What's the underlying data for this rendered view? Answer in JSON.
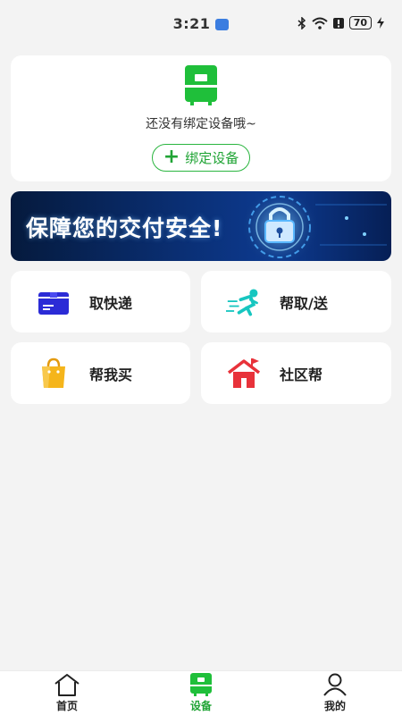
{
  "status_bar": {
    "time": "3:21",
    "battery": "70"
  },
  "device_card": {
    "empty_text": "还没有绑定设备哦~",
    "bind_label": "绑定设备"
  },
  "banner": {
    "text": "保障您的交付安全!"
  },
  "services": [
    {
      "label": "取快递",
      "icon": "package-box-icon",
      "color": "#2b2bd6"
    },
    {
      "label": "帮取/送",
      "icon": "runner-icon",
      "color": "#17c6c0"
    },
    {
      "label": "帮我买",
      "icon": "shopping-bag-icon",
      "color": "#f5b51b"
    },
    {
      "label": "社区帮",
      "icon": "house-icon",
      "color": "#e8323a"
    }
  ],
  "bottom_nav": {
    "items": [
      {
        "label": "首页",
        "icon": "home-icon"
      },
      {
        "label": "设备",
        "icon": "device-icon"
      },
      {
        "label": "我的",
        "icon": "profile-icon"
      }
    ],
    "active_index": 1
  },
  "colors": {
    "accent": "#20a435",
    "background": "#f3f3f3"
  }
}
